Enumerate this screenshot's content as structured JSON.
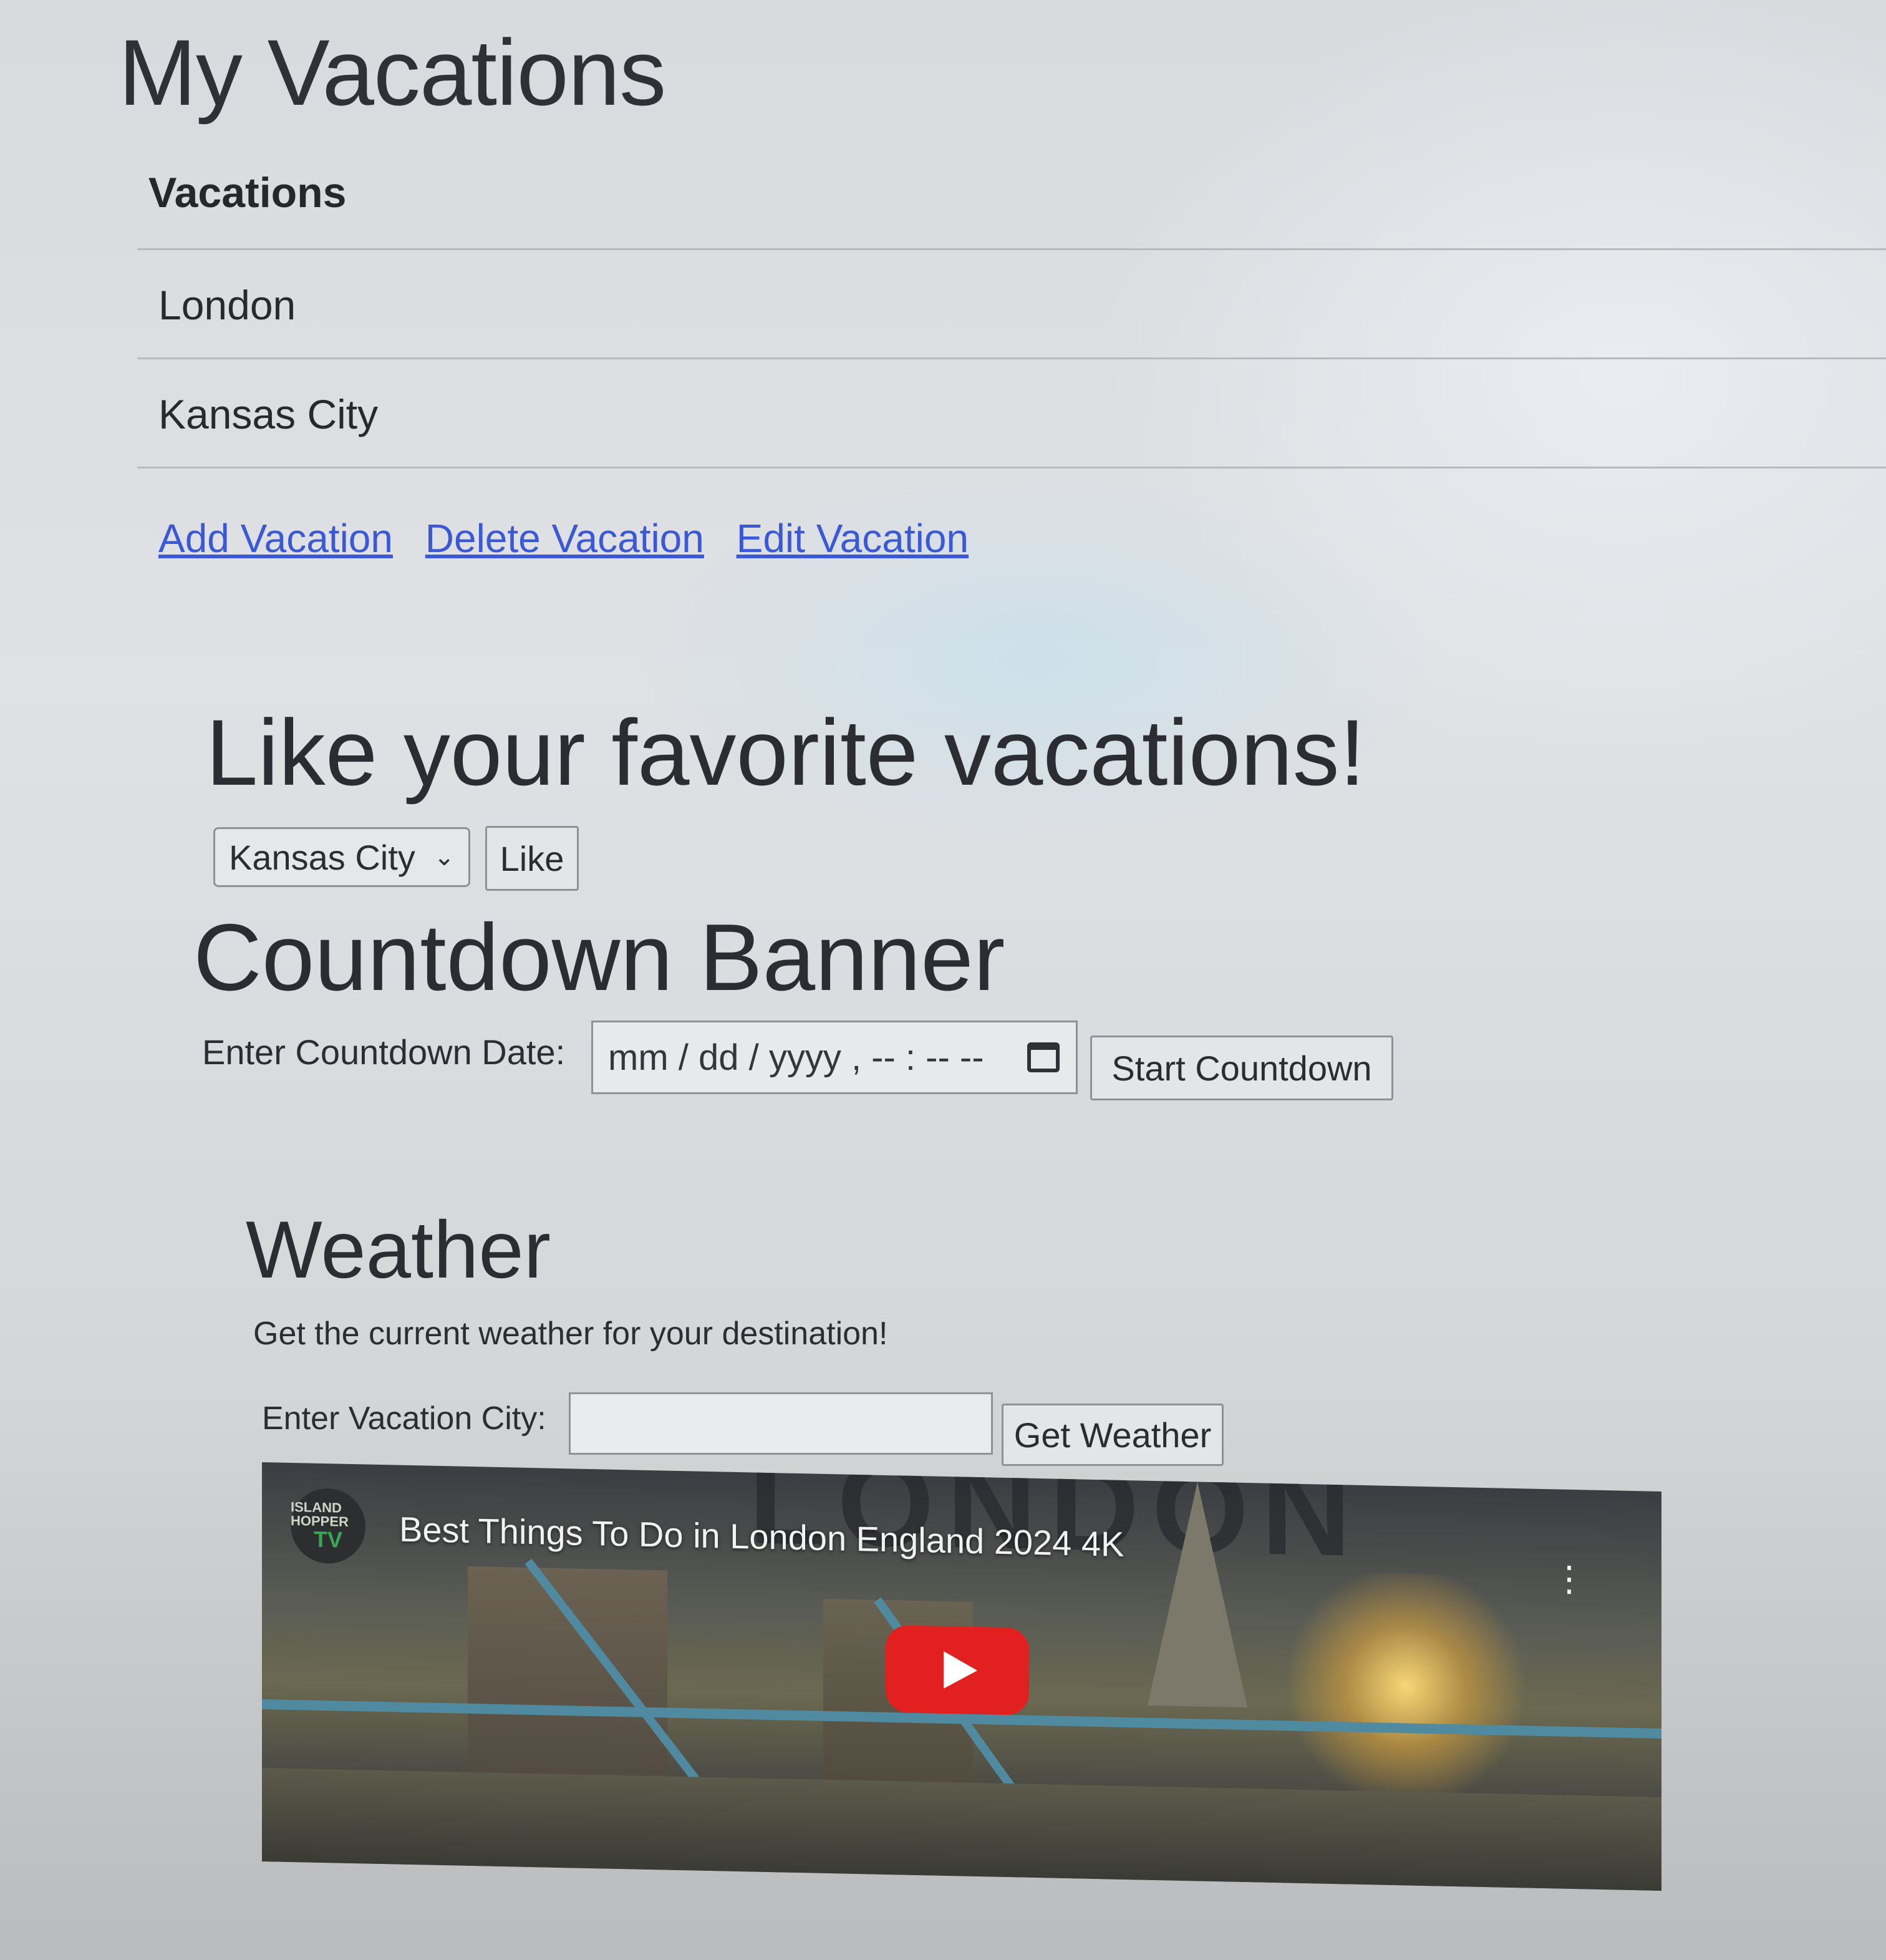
{
  "page": {
    "title": "My Vacations"
  },
  "vacations": {
    "header": "Vacations",
    "items": [
      {
        "label": "London"
      },
      {
        "label": "Kansas City"
      }
    ]
  },
  "links": {
    "add": "Add Vacation",
    "delete": "Delete Vacation",
    "edit": "Edit Vacation"
  },
  "like": {
    "heading": "Like your favorite vacations!",
    "selected": "Kansas City",
    "button": "Like"
  },
  "countdown": {
    "heading": "Countdown Banner",
    "label": "Enter Countdown Date:",
    "placeholder": "mm / dd / yyyy ,  -- : --   --",
    "button": "Start Countdown"
  },
  "weather": {
    "heading": "Weather",
    "subtitle": "Get the current weather for your destination!",
    "label": "Enter Vacation City:",
    "value": "",
    "button": "Get Weather"
  },
  "video": {
    "title": "Best Things To Do in London England 2024 4K",
    "background_text": "LONDON",
    "channel_top": "ISLAND HOPPER",
    "channel_bottom": "TV"
  },
  "colors": {
    "link": "#3b58d6",
    "play_button": "#e1201f"
  }
}
